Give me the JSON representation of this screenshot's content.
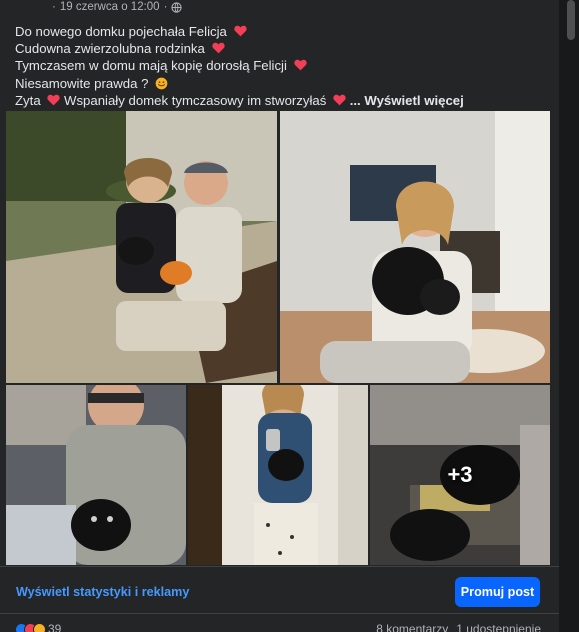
{
  "post": {
    "timestamp": "19 czerwca o 12:00",
    "lines": [
      "Do nowego domku pojechała Felicja",
      "Cudowna zwierzolubna rodzinka",
      "Tymczasem w domu mają kopię dorosłą  Felicji",
      "Niesamowite prawda ?",
      "Zyta",
      "Wspaniały domek tymczasowy im stworzyłaś",
      "... Wyświetl więcej"
    ]
  },
  "photos": {
    "more_count": "+3"
  },
  "actions": {
    "stats_label": "Wyświetl statystyki i reklamy",
    "promote_label": "Promuj post"
  },
  "engagement": {
    "reaction_count": "39",
    "comments": "8 komentarzy",
    "shares": "1 udostępnienie"
  },
  "colors": {
    "background": "#242526",
    "link": "#4599ff",
    "primary_button": "#0866ff",
    "heart": "#f33e58"
  }
}
